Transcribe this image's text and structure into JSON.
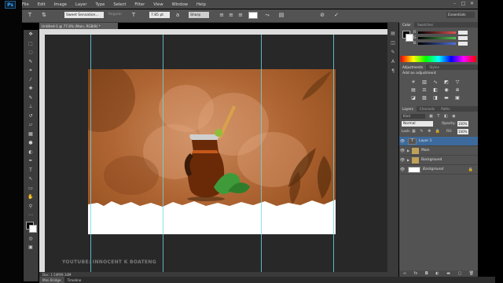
{
  "app": {
    "logo": "Ps"
  },
  "menu": [
    "File",
    "Edit",
    "Image",
    "Layer",
    "Type",
    "Select",
    "Filter",
    "View",
    "Window",
    "Help"
  ],
  "window_controls": [
    "–",
    "□",
    "✕"
  ],
  "options_bar": {
    "tool_icon": "T",
    "font_family": "Sweet Sensation...",
    "font_style": "Regular",
    "font_size": "7.85 pt",
    "antialias": "Sharp",
    "workspace": "Essentials"
  },
  "document": {
    "tab_title": "Untitled-1 @ 77.8% (Main, RGB/8) *",
    "status": "Doc: 1.54M/9.14M",
    "watermark": "YOUTUBE: INNOCENT K BOATENG"
  },
  "bottom_tabs": [
    "Mini Bridge",
    "Timeline"
  ],
  "color_panel": {
    "tabs": [
      "Color",
      "Swatches"
    ],
    "channels": [
      {
        "label": "R",
        "color": "#e05050"
      },
      {
        "label": "G",
        "color": "#50c050"
      },
      {
        "label": "B",
        "color": "#5070e0"
      }
    ]
  },
  "adjustments_panel": {
    "tabs": [
      "Adjustments",
      "Styles"
    ],
    "heading": "Add an adjustment"
  },
  "layers_panel": {
    "tabs": [
      "Layers",
      "Channels",
      "Paths"
    ],
    "filter_label": "Kind",
    "blend_mode": "Normal",
    "opacity_label": "Opacity:",
    "opacity_value": "100%",
    "lock_label": "Lock:",
    "fill_label": "Fill:",
    "fill_value": "100%",
    "layers": [
      {
        "name": "Layer 1",
        "type": "text",
        "selected": true
      },
      {
        "name": "Main",
        "type": "group",
        "selected": false
      },
      {
        "name": "Background",
        "type": "group",
        "selected": false
      },
      {
        "name": "Background",
        "type": "image",
        "selected": false
      }
    ]
  }
}
